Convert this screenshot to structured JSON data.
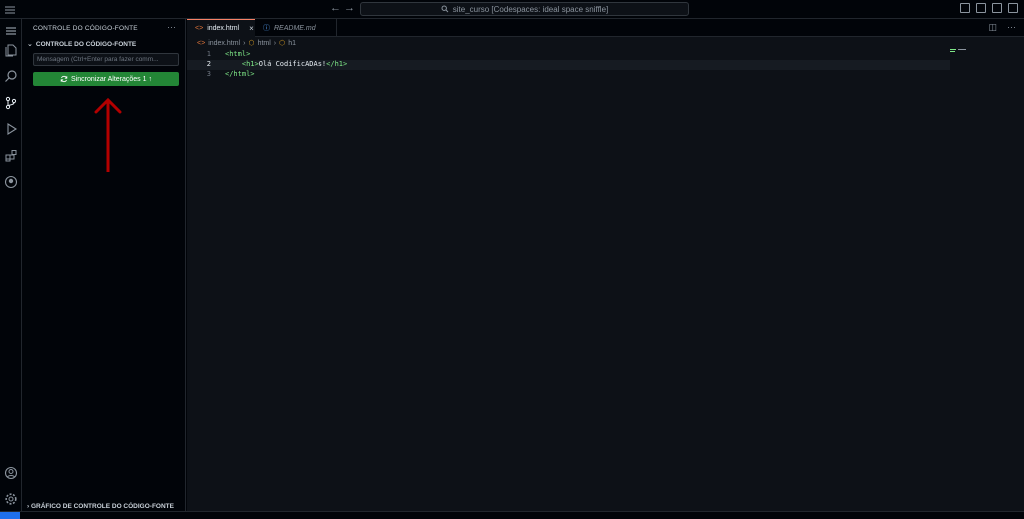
{
  "titlebar": {
    "back": "←",
    "forward": "→",
    "command_center": "site_curso [Codespaces: ideal space sniffle]"
  },
  "sidebar": {
    "title": "CONTROLE DO CÓDIGO-FONTE",
    "more": "···",
    "section_title": "CONTROLE DO CÓDIGO-FONTE",
    "commit_placeholder": "Mensagem (Ctrl+Enter para fazer comm...",
    "sync_button": "Sincronizar Alterações 1 ↑",
    "graph_section": "GRÁFICO DE CONTROLE DO CÓDIGO-FONTE"
  },
  "tabs": [
    {
      "label": "index.html",
      "active": true
    },
    {
      "label": "README.md",
      "active": false
    }
  ],
  "breadcrumb": [
    "index.html",
    "html",
    "h1"
  ],
  "editor": {
    "lines": [
      {
        "num": "1",
        "open": "<html>",
        "text": "",
        "close": ""
      },
      {
        "num": "2",
        "open": "    <h1>",
        "text": "Olá CodificADAs!",
        "close": "</h1>"
      },
      {
        "num": "3",
        "open": "</html>",
        "text": "",
        "close": ""
      }
    ],
    "current_line": 2
  },
  "colors": {
    "accent": "#238636",
    "tab_border": "#f78166",
    "arrow": "#b30000",
    "tag": "#7ee787"
  },
  "icons": [
    "menu-icon",
    "explorer-icon",
    "search-icon",
    "source-control-icon",
    "run-debug-icon",
    "extensions-icon",
    "github-icon",
    "account-icon",
    "settings-gear-icon"
  ]
}
